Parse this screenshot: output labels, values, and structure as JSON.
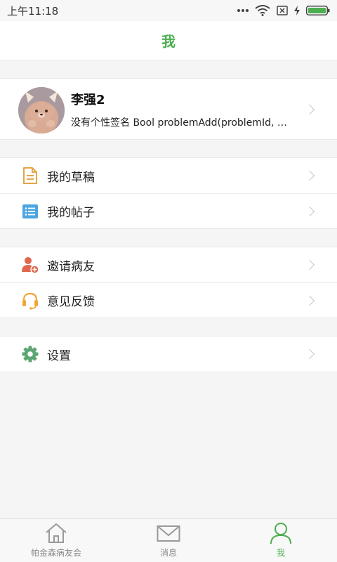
{
  "status_bar": {
    "time": "上午11:18"
  },
  "header": {
    "title": "我"
  },
  "profile": {
    "name": "李强2",
    "signature": "没有个性签名 Bool problemAdd(problemId, info)"
  },
  "menu_groups": [
    {
      "items": [
        {
          "label": "我的草稿",
          "icon": "draft-doc-icon"
        },
        {
          "label": "我的帖子",
          "icon": "post-list-icon"
        }
      ]
    },
    {
      "items": [
        {
          "label": "邀请病友",
          "icon": "invite-user-icon"
        },
        {
          "label": "意见反馈",
          "icon": "headset-icon"
        }
      ]
    },
    {
      "items": [
        {
          "label": "设置",
          "icon": "gear-icon"
        }
      ]
    }
  ],
  "tabbar": {
    "tabs": [
      {
        "label": "帕金森病友会",
        "icon": "home-icon"
      },
      {
        "label": "消息",
        "icon": "mail-icon"
      },
      {
        "label": "我",
        "icon": "person-icon",
        "active": true
      }
    ]
  },
  "colors": {
    "accent": "#4caf50",
    "draft": "#e6a545",
    "post": "#4ea5e0",
    "invite": "#e0664d",
    "feedback": "#f0a735",
    "settings": "#5ba672"
  }
}
